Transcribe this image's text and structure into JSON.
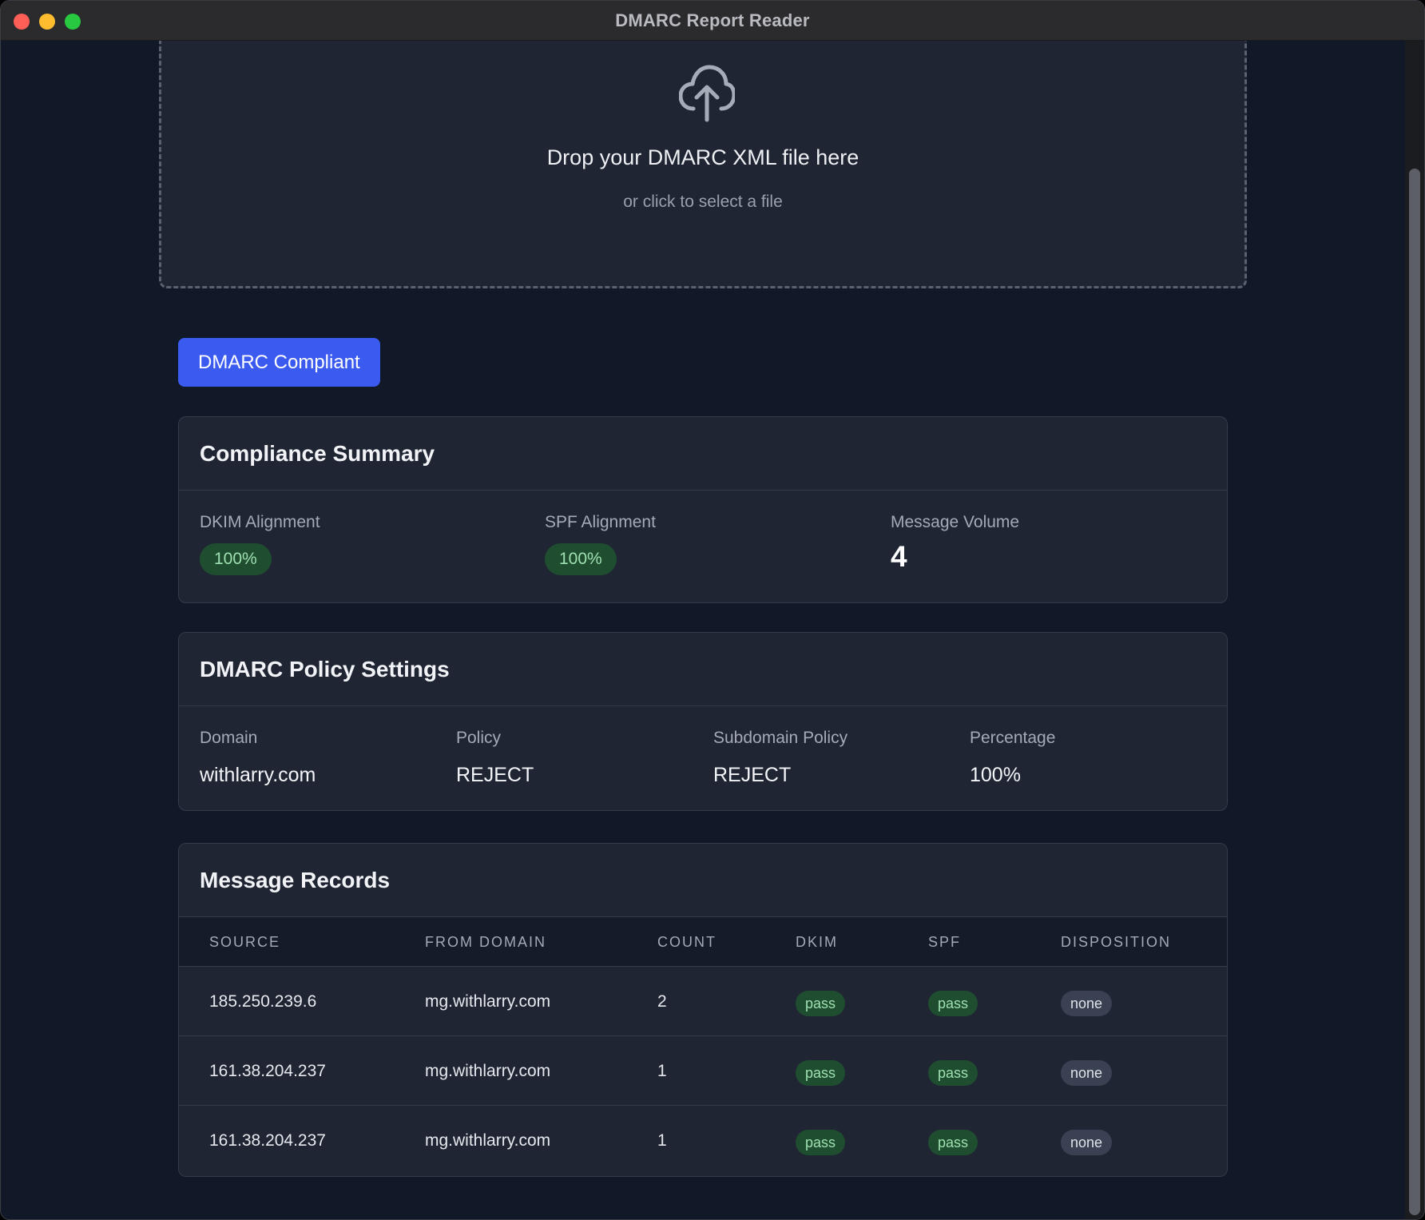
{
  "window": {
    "title": "DMARC Report Reader"
  },
  "dropzone": {
    "icon": "cloud-upload-icon",
    "title": "Drop your DMARC XML file here",
    "subtitle": "or click to select a file"
  },
  "status": {
    "label": "DMARC Compliant",
    "color": "#3b5bf0"
  },
  "summary": {
    "title": "Compliance Summary",
    "dkim": {
      "label": "DKIM Alignment",
      "value": "100%"
    },
    "spf": {
      "label": "SPF Alignment",
      "value": "100%"
    },
    "volume": {
      "label": "Message Volume",
      "value": "4"
    }
  },
  "policy": {
    "title": "DMARC Policy Settings",
    "fields": [
      {
        "label": "Domain",
        "value": "withlarry.com"
      },
      {
        "label": "Policy",
        "value": "REJECT"
      },
      {
        "label": "Subdomain Policy",
        "value": "REJECT"
      },
      {
        "label": "Percentage",
        "value": "100%"
      }
    ]
  },
  "records": {
    "title": "Message Records",
    "columns": [
      "SOURCE",
      "FROM DOMAIN",
      "COUNT",
      "DKIM",
      "SPF",
      "DISPOSITION"
    ],
    "rows": [
      {
        "source": "185.250.239.6",
        "from_domain": "mg.withlarry.com",
        "count": "2",
        "dkim": "pass",
        "spf": "pass",
        "disposition": "none"
      },
      {
        "source": "161.38.204.237",
        "from_domain": "mg.withlarry.com",
        "count": "1",
        "dkim": "pass",
        "spf": "pass",
        "disposition": "none"
      },
      {
        "source": "161.38.204.237",
        "from_domain": "mg.withlarry.com",
        "count": "1",
        "dkim": "pass",
        "spf": "pass",
        "disposition": "none"
      }
    ]
  },
  "colors": {
    "background": "#111827",
    "card": "#1f2533",
    "pass_bg": "#1f4d30",
    "pass_text": "#9ee0b0",
    "none_bg": "#3a4152"
  }
}
